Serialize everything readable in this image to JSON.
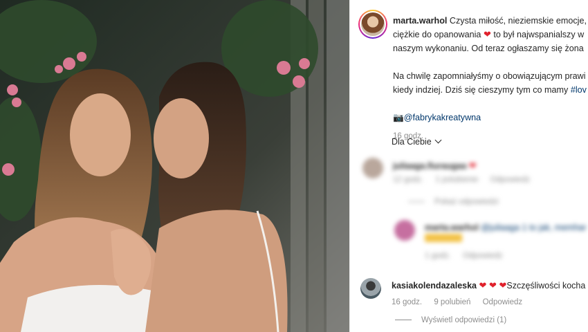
{
  "post": {
    "username": "marta.warhol",
    "caption_lines": [
      "Czysta miłość, nieziemskie emocje, w",
      "ciężkie do opanowania",
      "to był najwspanialszy w",
      "naszym wykonaniu. Od teraz ogłaszamy się żona"
    ],
    "caption2_lines": [
      "Na chwilę zapomniałyśmy o obowiązującym prawi",
      "kiedy indziej. Dziś się cieszymy tym co mamy",
      "#lov"
    ],
    "credit_icon": "camera-icon",
    "credit_tag": "@fabrykakreatywna",
    "time": "16 godz."
  },
  "filter": {
    "label": "Dla Ciebie"
  },
  "blurred": {
    "c1_user": "juliaaga.fiuraugaa",
    "c1_meta": [
      "12 godz.",
      "1 polubienie",
      "Odpowiedz"
    ],
    "c1_replies": "Pokaż odpowiedzi",
    "c2_user": "marta.warhol",
    "c2_text": "@juliaaga 1 to jak, memhar",
    "c2_meta": [
      "1 godz.",
      "Odpowiedz"
    ]
  },
  "comment": {
    "username": "kasiakolendazaleska",
    "hearts": "❤ ❤ ❤",
    "text": "Szczęśliwości kocha",
    "time": "16 godz.",
    "likes": "9 polubień",
    "reply": "Odpowiedz",
    "view_replies": "Wyświetl odpowiedzi (1)"
  },
  "colors": {
    "accent_link": "#00376b",
    "heart": "#e0212c",
    "muted": "#8e8e8e"
  }
}
